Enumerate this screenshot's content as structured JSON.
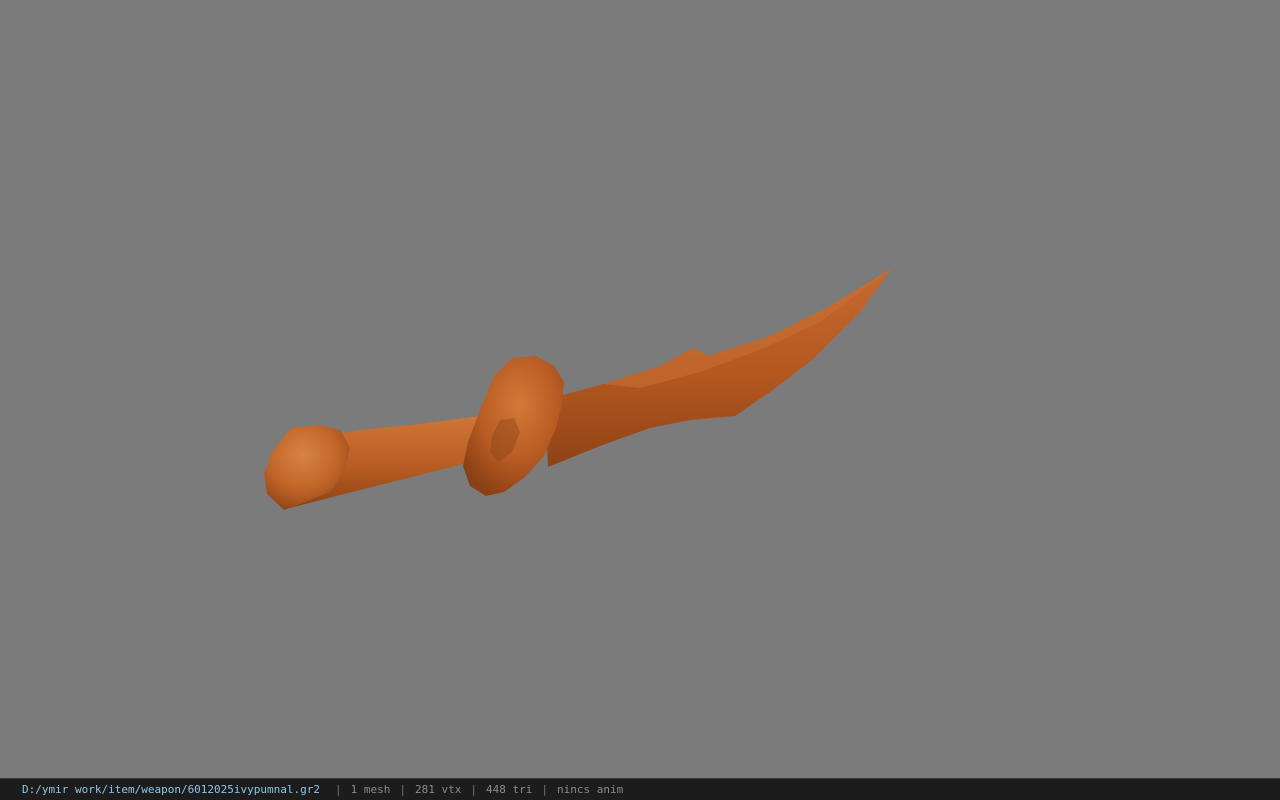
{
  "viewer": {
    "background_color": "#7b7b7b",
    "model": {
      "object": "dagger-model",
      "color": "#c2652b"
    }
  },
  "status_bar": {
    "file_path": "D:/ymir work/item/weapon/6012025ivypumnal.gr2",
    "separator": "|",
    "mesh_count": "1 mesh",
    "vertex_count": "281 vtx",
    "triangle_count": "448 tri",
    "animation": "nincs anim"
  }
}
